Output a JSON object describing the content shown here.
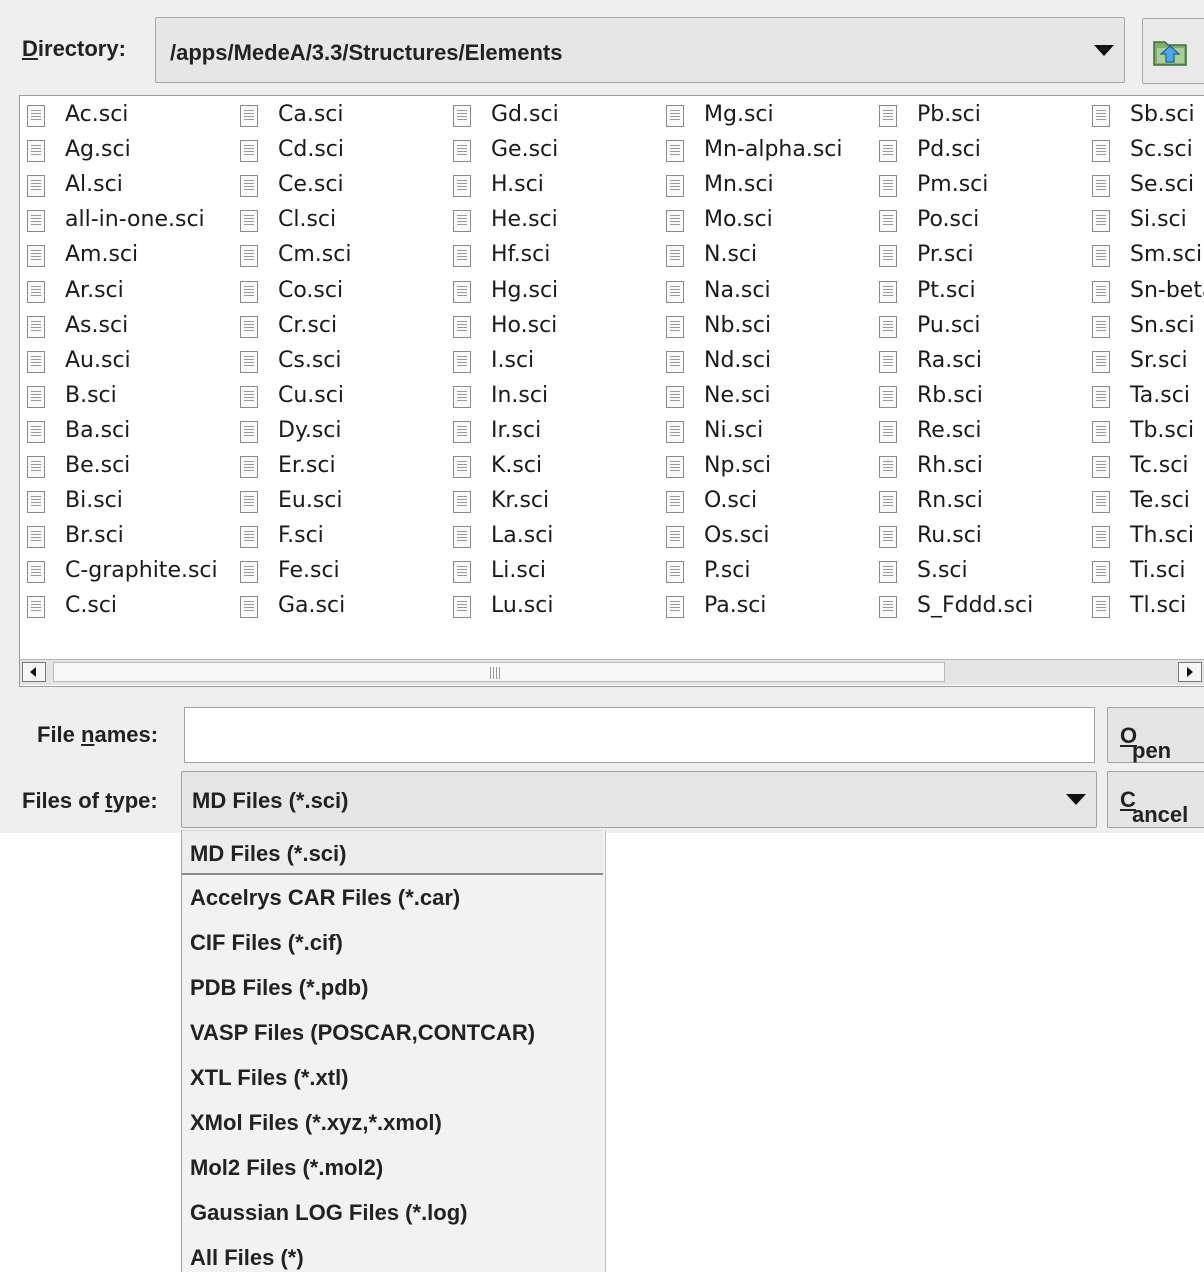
{
  "directory": {
    "label_prefix": "D",
    "label_rest": "irectory:",
    "path": "/apps/MedeA/3.3/Structures/Elements",
    "up_icon": "folder-up-icon"
  },
  "file_list": {
    "columns": [
      [
        "Ac.sci",
        "Ag.sci",
        "Al.sci",
        "all-in-one.sci",
        "Am.sci",
        "Ar.sci",
        "As.sci",
        "Au.sci",
        "B.sci",
        "Ba.sci",
        "Be.sci",
        "Bi.sci",
        "Br.sci",
        "C-graphite.sci",
        "C.sci"
      ],
      [
        "Ca.sci",
        "Cd.sci",
        "Ce.sci",
        "Cl.sci",
        "Cm.sci",
        "Co.sci",
        "Cr.sci",
        "Cs.sci",
        "Cu.sci",
        "Dy.sci",
        "Er.sci",
        "Eu.sci",
        "F.sci",
        "Fe.sci",
        "Ga.sci"
      ],
      [
        "Gd.sci",
        "Ge.sci",
        "H.sci",
        "He.sci",
        "Hf.sci",
        "Hg.sci",
        "Ho.sci",
        "I.sci",
        "In.sci",
        "Ir.sci",
        "K.sci",
        "Kr.sci",
        "La.sci",
        "Li.sci",
        "Lu.sci"
      ],
      [
        "Mg.sci",
        "Mn-alpha.sci",
        "Mn.sci",
        "Mo.sci",
        "N.sci",
        "Na.sci",
        "Nb.sci",
        "Nd.sci",
        "Ne.sci",
        "Ni.sci",
        "Np.sci",
        "O.sci",
        "Os.sci",
        "P.sci",
        "Pa.sci"
      ],
      [
        "Pb.sci",
        "Pd.sci",
        "Pm.sci",
        "Po.sci",
        "Pr.sci",
        "Pt.sci",
        "Pu.sci",
        "Ra.sci",
        "Rb.sci",
        "Re.sci",
        "Rh.sci",
        "Rn.sci",
        "Ru.sci",
        "S.sci",
        "S_Fddd.sci"
      ],
      [
        "Sb.sci",
        "Sc.sci",
        "Se.sci",
        "Si.sci",
        "Sm.sci",
        "Sn-beta.sci",
        "Sn.sci",
        "Sr.sci",
        "Ta.sci",
        "Tb.sci",
        "Tc.sci",
        "Te.sci",
        "Th.sci",
        "Ti.sci",
        "Tl.sci"
      ]
    ],
    "file_icon": "document-icon"
  },
  "file_names": {
    "label_a": "File ",
    "label_u": "n",
    "label_b": "ames:",
    "value": ""
  },
  "open_button": {
    "u": "O",
    "rest": "pen"
  },
  "files_of_type": {
    "label_a": "Files of ",
    "label_u": "t",
    "label_b": "ype:",
    "selected": "MD Files (*.sci)",
    "options": [
      "MD Files (*.sci)",
      "Accelrys CAR Files (*.car)",
      "CIF Files (*.cif)",
      "PDB Files (*.pdb)",
      "VASP Files (POSCAR,CONTCAR)",
      "XTL Files (*.xtl)",
      "XMol Files (*.xyz,*.xmol)",
      "Mol2 Files (*.mol2)",
      "Gaussian LOG Files (*.log)",
      "All Files (*)"
    ]
  },
  "cancel_button": {
    "u": "C",
    "rest": "ancel"
  }
}
